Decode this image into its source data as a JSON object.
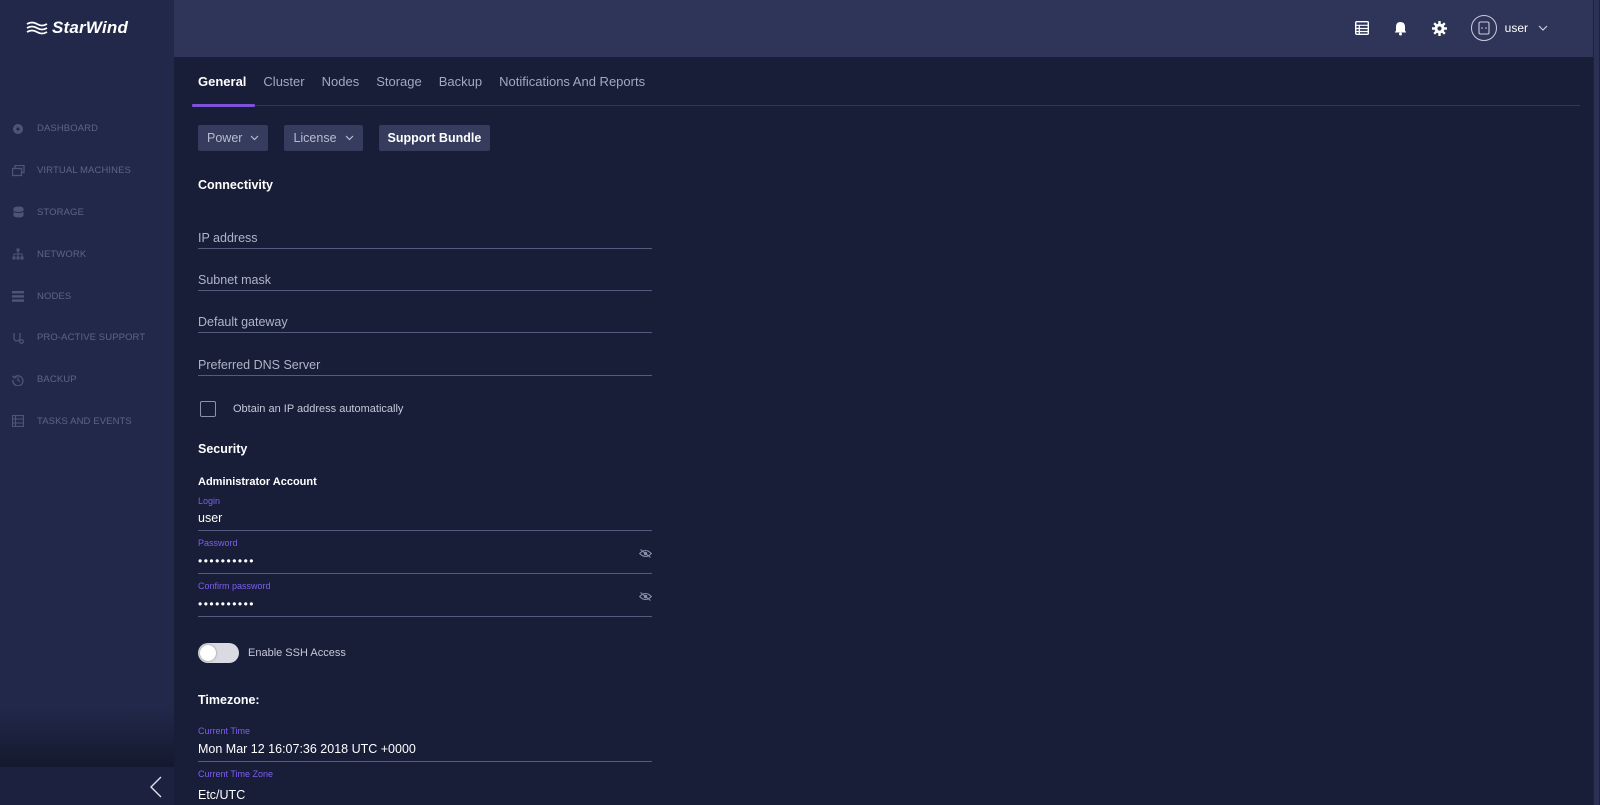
{
  "brand": {
    "name": "StarWind"
  },
  "sidebar": {
    "items": [
      {
        "label": "DASHBOARD",
        "icon": "dashboard-icon"
      },
      {
        "label": "VIRTUAL MACHINES",
        "icon": "virtual-machines-icon"
      },
      {
        "label": "STORAGE",
        "icon": "storage-icon"
      },
      {
        "label": "NETWORK",
        "icon": "network-icon"
      },
      {
        "label": "NODES",
        "icon": "nodes-icon"
      },
      {
        "label": "PRO-ACTIVE SUPPORT",
        "icon": "support-icon"
      },
      {
        "label": "BACKUP",
        "icon": "backup-icon"
      },
      {
        "label": "TASKS AND EVENTS",
        "icon": "tasks-icon"
      }
    ]
  },
  "header": {
    "icons": [
      "tasks-list-icon",
      "bell-icon",
      "gear-icon"
    ],
    "user": {
      "name": "user"
    }
  },
  "tabs": [
    {
      "label": "General",
      "active": true
    },
    {
      "label": "Cluster",
      "active": false
    },
    {
      "label": "Nodes",
      "active": false
    },
    {
      "label": "Storage",
      "active": false
    },
    {
      "label": "Backup",
      "active": false
    },
    {
      "label": "Notifications And Reports",
      "active": false
    }
  ],
  "actions": {
    "power": "Power",
    "license": "License",
    "support_bundle": "Support Bundle"
  },
  "connectivity": {
    "title": "Connectivity",
    "ip_address": {
      "placeholder": "IP address"
    },
    "subnet_mask": {
      "placeholder": "Subnet mask"
    },
    "default_gateway": {
      "placeholder": "Default gateway"
    },
    "dns": {
      "placeholder": "Preferred DNS Server"
    },
    "auto_ip": {
      "label": "Obtain an IP address automatically",
      "checked": false
    }
  },
  "security": {
    "title": "Security",
    "account_title": "Administrator Account",
    "login": {
      "label": "Login",
      "value": "user"
    },
    "password": {
      "label": "Password",
      "value": "••••••••••"
    },
    "confirm_password": {
      "label": "Confirm password",
      "value": "••••••••••"
    },
    "ssh": {
      "label": "Enable SSH Access",
      "enabled": false
    }
  },
  "timezone": {
    "title": "Timezone:",
    "current_time": {
      "label": "Current Time",
      "value": "Mon Mar 12 16:07:36 2018 UTC +0000"
    },
    "current_zone": {
      "label": "Current Time Zone",
      "value": "Etc/UTC"
    }
  },
  "colors": {
    "accent": "#7b52d9",
    "background": "#181d38",
    "sidebar": "#22284a",
    "topbar": "#2f3558"
  }
}
